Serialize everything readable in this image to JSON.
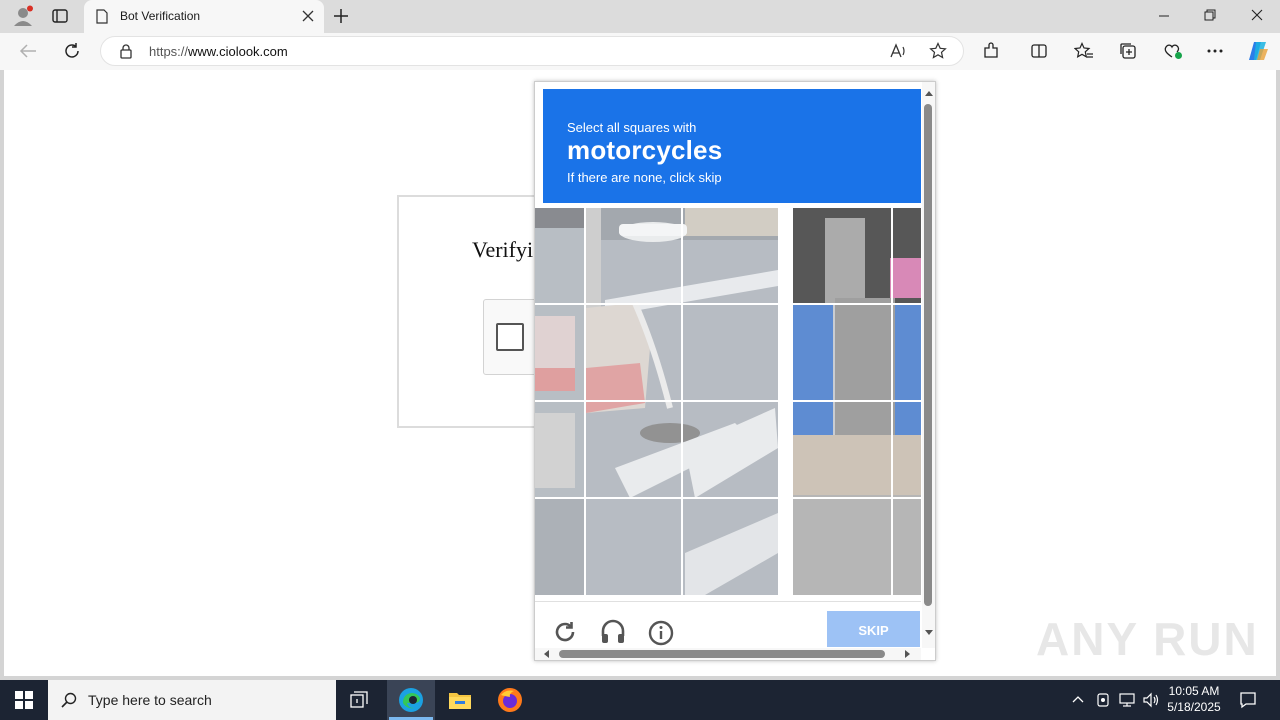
{
  "browser": {
    "tab_title": "Bot Verification",
    "url_scheme": "https://",
    "url_host": "www.ciolook.com"
  },
  "page": {
    "heading": "Verifyi"
  },
  "challenge": {
    "prompt_line1": "Select all squares with",
    "prompt_object": "motorcycles",
    "prompt_line3": "If there are none, click skip",
    "skip_label": "SKIP",
    "header_color": "#1a73e8",
    "skip_color": "#9dc2f5"
  },
  "watermark": "ANY RUN",
  "taskbar": {
    "search_placeholder": "Type here to search",
    "time": "10:05 AM",
    "date": "5/18/2025"
  },
  "icons": [
    "profile-icon",
    "tab-actions-icon",
    "page-icon",
    "tab-close-icon",
    "new-tab-icon",
    "minimize-icon",
    "restore-icon",
    "window-close-icon",
    "back-icon",
    "refresh-icon",
    "lock-icon",
    "read-aloud-icon",
    "favorite-star-icon",
    "extensions-icon",
    "split-screen-icon",
    "favorites-icon",
    "collections-icon",
    "browser-essentials-icon",
    "more-icon",
    "copilot-icon",
    "reload-challenge-icon",
    "audio-challenge-icon",
    "info-icon",
    "windows-start-icon",
    "search-icon",
    "task-view-icon",
    "edge-icon",
    "file-explorer-icon",
    "firefox-icon",
    "chevron-up-icon",
    "network-icon",
    "volume-icon",
    "notification-icon"
  ]
}
